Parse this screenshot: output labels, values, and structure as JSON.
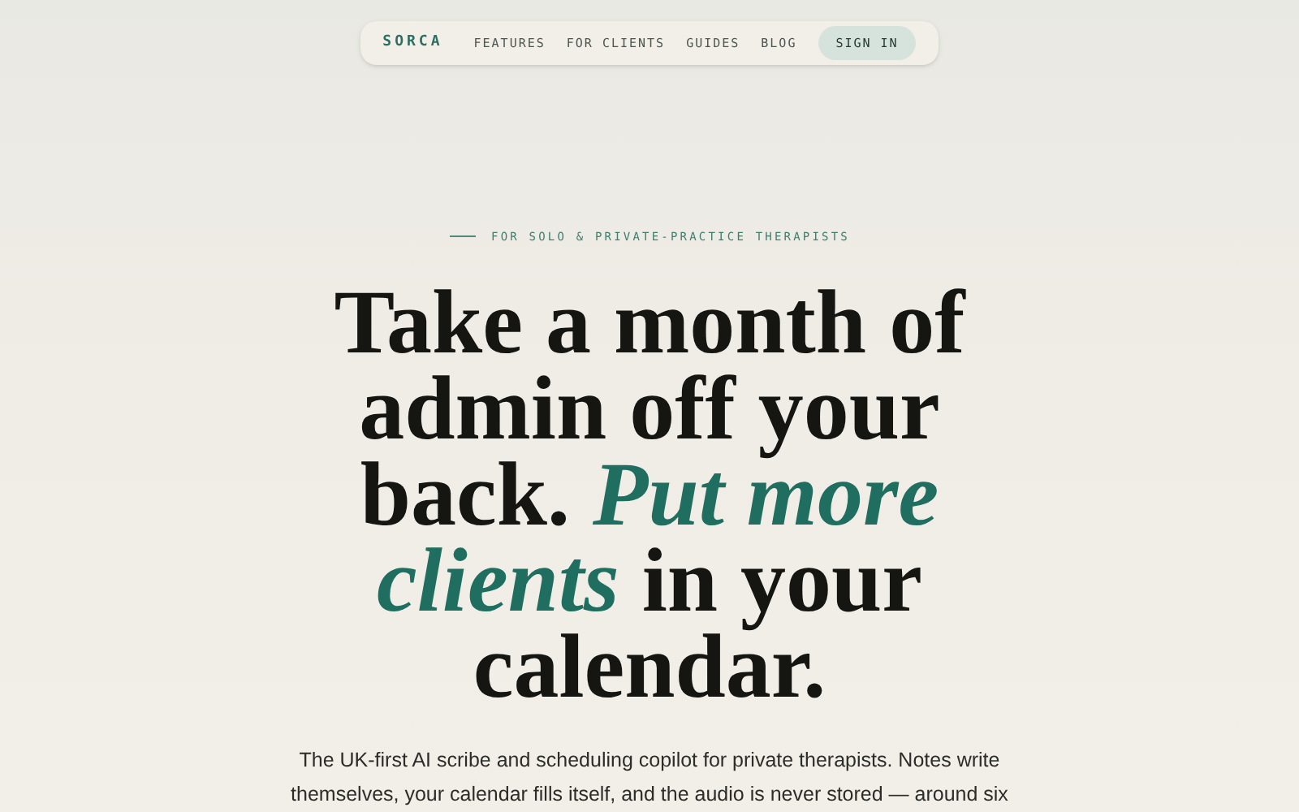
{
  "nav": {
    "brand": "SORCA",
    "links": [
      {
        "label": "FEATURES"
      },
      {
        "label": "FOR CLIENTS"
      },
      {
        "label": "GUIDES"
      },
      {
        "label": "BLOG"
      }
    ],
    "button": "SIGN IN"
  },
  "hero": {
    "eyebrow": "FOR SOLO & PRIVATE-PRACTICE THERAPISTS",
    "headline": "Take a month of admin off your back. *Put more clients* in your calendar.",
    "lead": "The UK-first AI scribe and scheduling copilot for private therapists. Notes write themselves, your calendar fills itself, and the audio is never stored — around six"
  }
}
